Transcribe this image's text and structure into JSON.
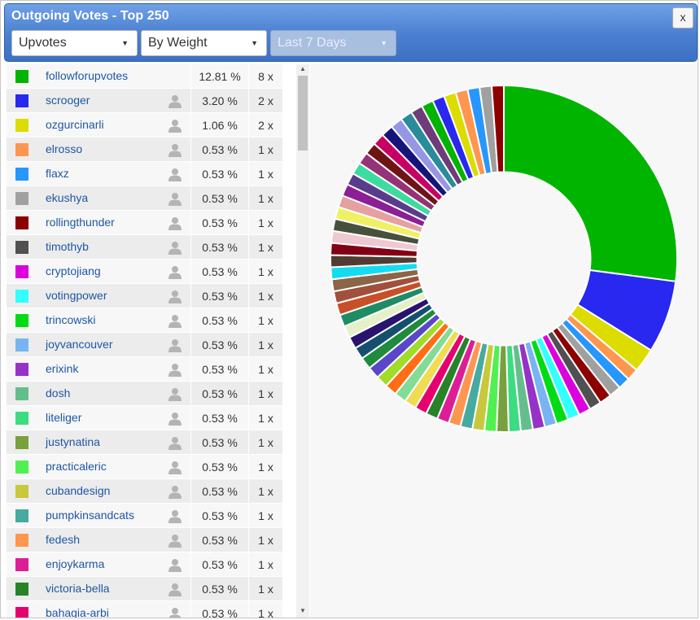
{
  "window": {
    "title": "Outgoing Votes - Top 250",
    "close_label": "x"
  },
  "filters": {
    "type": {
      "value": "Upvotes"
    },
    "sort": {
      "value": "By Weight"
    },
    "period": {
      "value": "Last 7 Days"
    }
  },
  "list": {
    "rows": [
      {
        "name": "followforupvotes",
        "pct": "12.81 %",
        "count": "8 x",
        "color": "#00b400",
        "show_person": false
      },
      {
        "name": "scrooger",
        "pct": "3.20 %",
        "count": "2 x",
        "color": "#2828f0",
        "show_person": true
      },
      {
        "name": "ozgurcinarli",
        "pct": "1.06 %",
        "count": "2 x",
        "color": "#dcdc00",
        "show_person": true
      },
      {
        "name": "elrosso",
        "pct": "0.53 %",
        "count": "1 x",
        "color": "#ff9650",
        "show_person": true
      },
      {
        "name": "flaxz",
        "pct": "0.53 %",
        "count": "1 x",
        "color": "#2896ff",
        "show_person": true
      },
      {
        "name": "ekushya",
        "pct": "0.53 %",
        "count": "1 x",
        "color": "#a0a0a0",
        "show_person": true
      },
      {
        "name": "rollingthunder",
        "pct": "0.53 %",
        "count": "1 x",
        "color": "#8c0000",
        "show_person": true
      },
      {
        "name": "timothyb",
        "pct": "0.53 %",
        "count": "1 x",
        "color": "#505050",
        "show_person": true
      },
      {
        "name": "cryptojiang",
        "pct": "0.53 %",
        "count": "1 x",
        "color": "#dc00dc",
        "show_person": true
      },
      {
        "name": "votingpower",
        "pct": "0.53 %",
        "count": "1 x",
        "color": "#32ffff",
        "show_person": true
      },
      {
        "name": "trincowski",
        "pct": "0.53 %",
        "count": "1 x",
        "color": "#00dc14",
        "show_person": true
      },
      {
        "name": "joyvancouver",
        "pct": "0.53 %",
        "count": "1 x",
        "color": "#78b4f0",
        "show_person": true
      },
      {
        "name": "erixink",
        "pct": "0.53 %",
        "count": "1 x",
        "color": "#9632c8",
        "show_person": true
      },
      {
        "name": "dosh",
        "pct": "0.53 %",
        "count": "1 x",
        "color": "#64be8c",
        "show_person": true
      },
      {
        "name": "liteliger",
        "pct": "0.53 %",
        "count": "1 x",
        "color": "#3cdc82",
        "show_person": true
      },
      {
        "name": "justynatina",
        "pct": "0.53 %",
        "count": "1 x",
        "color": "#78a03c",
        "show_person": true
      },
      {
        "name": "practicaleric",
        "pct": "0.53 %",
        "count": "1 x",
        "color": "#50f050",
        "show_person": true
      },
      {
        "name": "cubandesign",
        "pct": "0.53 %",
        "count": "1 x",
        "color": "#c8c83c",
        "show_person": true
      },
      {
        "name": "pumpkinsandcats",
        "pct": "0.53 %",
        "count": "1 x",
        "color": "#46aaa0",
        "show_person": true
      },
      {
        "name": "fedesh",
        "pct": "0.53 %",
        "count": "1 x",
        "color": "#ff9650",
        "show_person": true
      },
      {
        "name": "enjoykarma",
        "pct": "0.53 %",
        "count": "1 x",
        "color": "#dc1e96",
        "show_person": true
      },
      {
        "name": "victoria-bella",
        "pct": "0.53 %",
        "count": "1 x",
        "color": "#288228",
        "show_person": true
      },
      {
        "name": "bahagia-arbi",
        "pct": "0.53 %",
        "count": "1 x",
        "color": "#e6006e",
        "show_person": true
      }
    ]
  },
  "chart_data": {
    "type": "pie",
    "series": [
      {
        "values": [
          12.81,
          3.2,
          1.06,
          0.53,
          0.53,
          0.53,
          0.53,
          0.53,
          0.53,
          0.53,
          0.53,
          0.53,
          0.53,
          0.53,
          0.53,
          0.53,
          0.53,
          0.53,
          0.53,
          0.53,
          0.53,
          0.53,
          0.53,
          0.53,
          0.53,
          0.53,
          0.53,
          0.53,
          0.53,
          0.53,
          0.53,
          0.53,
          0.53,
          0.53,
          0.53,
          0.53,
          0.53,
          0.53,
          0.53,
          0.53,
          0.53,
          0.53,
          0.53,
          0.53,
          0.53,
          0.53,
          0.53,
          0.53,
          0.53,
          0.53,
          0.53,
          0.53,
          0.53,
          0.53,
          0.53,
          0.53,
          0.53,
          0.53,
          0.53,
          0.53
        ]
      }
    ],
    "colors": [
      "#00b400",
      "#2828f0",
      "#dcdc00",
      "#ff9650",
      "#2896ff",
      "#a0a0a0",
      "#8c0000",
      "#505050",
      "#dc00dc",
      "#32ffff",
      "#00dc14",
      "#78b4f0",
      "#9632c8",
      "#64be8c",
      "#3cdc82",
      "#78a03c",
      "#50f050",
      "#c8c83c",
      "#46aaa0",
      "#ff9650",
      "#dc1e96",
      "#288228",
      "#e6006e",
      "#f0dc50",
      "#82dc96",
      "#ff6e14",
      "#a0dc28",
      "#5a46c8",
      "#1e8c3c",
      "#14506e",
      "#28146e",
      "#e6f0c8",
      "#1e8c64",
      "#c85028",
      "#a0503c",
      "#8c6446",
      "#14dcf0",
      "#503c32",
      "#820014",
      "#f0c8d2",
      "#46503c",
      "#f0f064",
      "#e6a0a0",
      "#8c1e96",
      "#5a3c8c",
      "#3cdca0",
      "#963278",
      "#6e1414",
      "#c80064",
      "#14147a",
      "#9696e6",
      "#288c9b",
      "#6e3c78"
    ],
    "inner_radius_ratio": 0.5
  }
}
